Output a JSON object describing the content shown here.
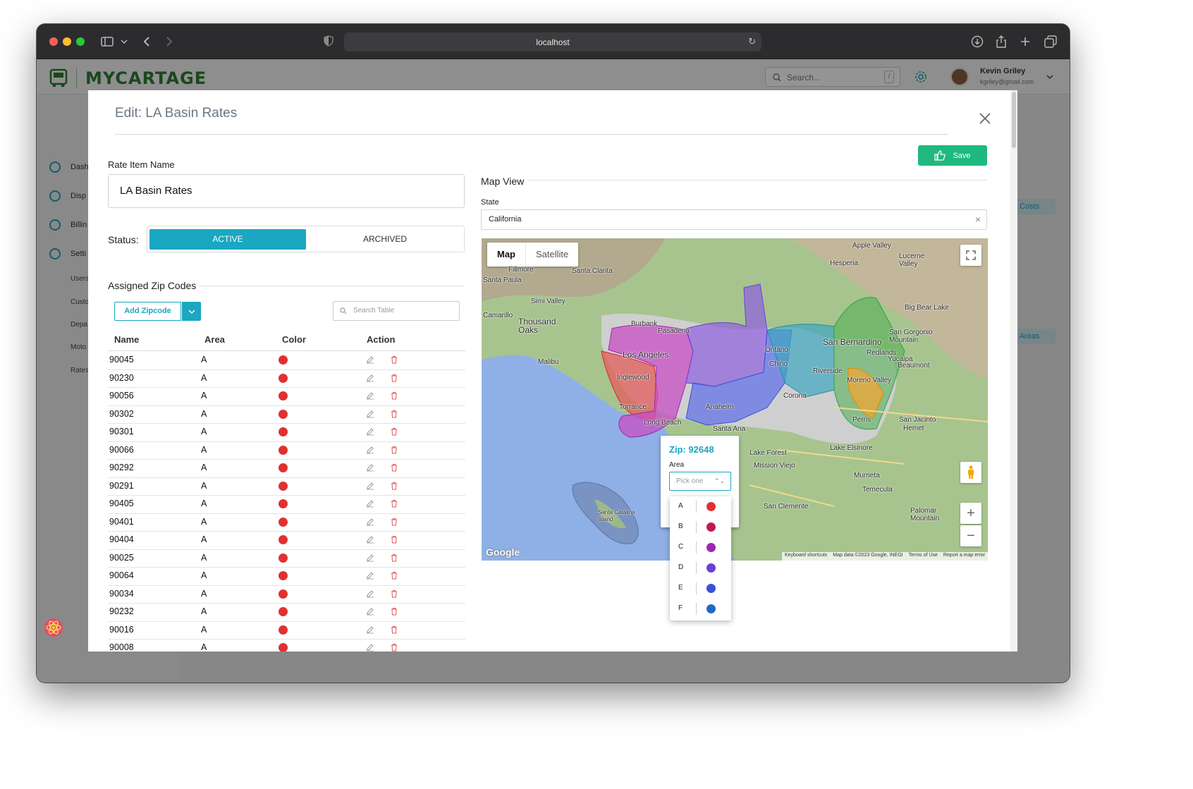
{
  "browser": {
    "url": "localhost"
  },
  "app": {
    "brand": "MYCARTAGE",
    "search_placeholder": "Search...",
    "search_shortcut": "/",
    "user": {
      "name": "Kevin Griley",
      "email": "kgriley@gmail.com"
    },
    "sidebar": [
      {
        "label": "Dash",
        "icon": "dashboard-icon"
      },
      {
        "label": "Disp",
        "icon": "truck-icon"
      },
      {
        "label": "Billin",
        "icon": "billing-icon"
      },
      {
        "label": "Setti",
        "icon": "settings-icon"
      }
    ],
    "sidebar_sub": [
      "Users",
      "Custo",
      "Depa",
      "Moto",
      "Rates"
    ],
    "bg_buttons": [
      "d Costs",
      "d Areas"
    ]
  },
  "modal": {
    "title": "Edit: LA Basin Rates",
    "save_label": "Save",
    "name_label": "Rate Item Name",
    "name_value": "LA Basin Rates",
    "status_label": "Status:",
    "status_options": [
      "ACTIVE",
      "ARCHIVED"
    ],
    "status_selected": "ACTIVE",
    "zip_section_title": "Assigned Zip Codes",
    "add_zip_label": "Add Zipcode",
    "table_search_placeholder": "Search Table",
    "table": {
      "columns": [
        "Name",
        "Area",
        "Color",
        "Action"
      ],
      "rows": [
        {
          "name": "90045",
          "area": "A",
          "color": "#e03131"
        },
        {
          "name": "90230",
          "area": "A",
          "color": "#e03131"
        },
        {
          "name": "90056",
          "area": "A",
          "color": "#e03131"
        },
        {
          "name": "90302",
          "area": "A",
          "color": "#e03131"
        },
        {
          "name": "90301",
          "area": "A",
          "color": "#e03131"
        },
        {
          "name": "90066",
          "area": "A",
          "color": "#e03131"
        },
        {
          "name": "90292",
          "area": "A",
          "color": "#e03131"
        },
        {
          "name": "90291",
          "area": "A",
          "color": "#e03131"
        },
        {
          "name": "90405",
          "area": "A",
          "color": "#e03131"
        },
        {
          "name": "90401",
          "area": "A",
          "color": "#e03131"
        },
        {
          "name": "90404",
          "area": "A",
          "color": "#e03131"
        },
        {
          "name": "90025",
          "area": "A",
          "color": "#e03131"
        },
        {
          "name": "90064",
          "area": "A",
          "color": "#e03131"
        },
        {
          "name": "90034",
          "area": "A",
          "color": "#e03131"
        },
        {
          "name": "90232",
          "area": "A",
          "color": "#e03131"
        },
        {
          "name": "90016",
          "area": "A",
          "color": "#e03131"
        },
        {
          "name": "90008",
          "area": "A",
          "color": "#e03131"
        }
      ]
    },
    "map_view_title": "Map View",
    "state_label": "State",
    "state_value": "California",
    "map": {
      "type_options": [
        "Map",
        "Satellite"
      ],
      "type_selected": "Map",
      "labels": [
        "Santa Clarita",
        "Simi Valley",
        "Thousand Oaks",
        "Malibu",
        "Fillmore",
        "Burbank",
        "Pasadena",
        "Los Angeles",
        "Inglewood",
        "Torrance",
        "Long Beach",
        "Anaheim",
        "Santa Ana",
        "Ontario",
        "Chino",
        "Corona",
        "San Bernardino",
        "Riverside",
        "Redlands",
        "Yucaipa",
        "Moreno Valley",
        "Perris",
        "Hemet",
        "Lake Elsinore",
        "Murrieta",
        "Temecula",
        "San Clemente",
        "Lake Forest",
        "Mission Viejo",
        "Apple Valley",
        "Hesperia",
        "Lucerne Valley",
        "Big Bear Lake",
        "San Gorgonio Mountain",
        "Beaumont",
        "San Jacinto",
        "Palomar Mountain",
        "Santa Catalina Island",
        "Camarillo",
        "Santa Paula"
      ],
      "attribution": [
        "Keyboard shortcuts",
        "Map data ©2023 Google, INEGI",
        "Terms of Use",
        "Report a map error"
      ],
      "google": "Google"
    },
    "popup": {
      "title": "Zip: 92648",
      "area_label": "Area",
      "select_placeholder": "Pick one",
      "options": [
        {
          "label": "A",
          "color": "#e03131"
        },
        {
          "label": "B",
          "color": "#c2185b"
        },
        {
          "label": "C",
          "color": "#9c27b0"
        },
        {
          "label": "D",
          "color": "#6a3fd6"
        },
        {
          "label": "E",
          "color": "#3d4fd8"
        },
        {
          "label": "F",
          "color": "#1f6bc4"
        }
      ]
    }
  }
}
